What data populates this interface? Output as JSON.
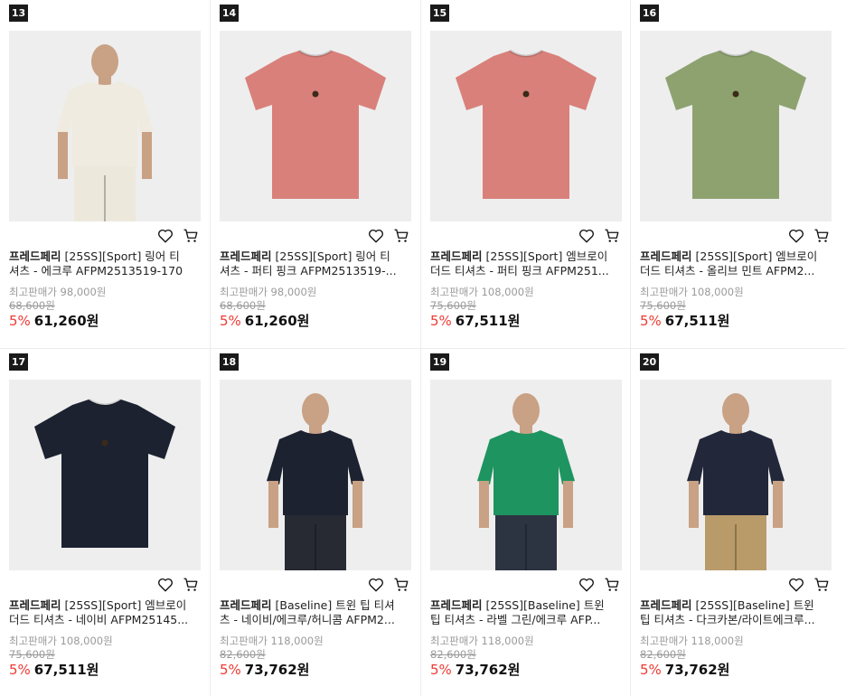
{
  "products": [
    {
      "rank": "13",
      "brand": "프레드페리",
      "title": "[25SS][Sport] 링어 티셔츠 - 에크루 AFPM2513519-170",
      "max_price": "최고판매가 98,000원",
      "original_price": "68,600원",
      "discount": "5%",
      "price": "61,260원",
      "shirt_color": "#efebe0",
      "image": "model",
      "pants_color": "#ece8dc"
    },
    {
      "rank": "14",
      "brand": "프레드페리",
      "title": "[25SS][Sport] 링어 티셔츠 - 퍼티 핑크 AFPM2513519-...",
      "max_price": "최고판매가 98,000원",
      "original_price": "68,600원",
      "discount": "5%",
      "price": "61,260원",
      "shirt_color": "#d9807b",
      "image": "shirt"
    },
    {
      "rank": "15",
      "brand": "프레드페리",
      "title": "[25SS][Sport] 엠브로이더드 티셔츠 - 퍼티 핑크 AFPM251...",
      "max_price": "최고판매가 108,000원",
      "original_price": "75,600원",
      "discount": "5%",
      "price": "67,511원",
      "shirt_color": "#d9807b",
      "image": "shirt"
    },
    {
      "rank": "16",
      "brand": "프레드페리",
      "title": "[25SS][Sport] 엠브로이더드 티셔츠 - 올리브 민트 AFPM2...",
      "max_price": "최고판매가 108,000원",
      "original_price": "75,600원",
      "discount": "5%",
      "price": "67,511원",
      "shirt_color": "#8ea270",
      "image": "shirt"
    },
    {
      "rank": "17",
      "brand": "프레드페리",
      "title": "[25SS][Sport] 엠브로이더드 티셔츠 - 네이비 AFPM25145...",
      "max_price": "최고판매가 108,000원",
      "original_price": "75,600원",
      "discount": "5%",
      "price": "67,511원",
      "shirt_color": "#1c2230",
      "image": "shirt"
    },
    {
      "rank": "18",
      "brand": "프레드페리",
      "title": "[Baseline] 트윈 팁 티셔츠 - 네이비/에크루/허니콤 AFPM2...",
      "max_price": "최고판매가 118,000원",
      "original_price": "82,600원",
      "discount": "5%",
      "price": "73,762원",
      "shirt_color": "#1d2230",
      "image": "model",
      "pants_color": "#272a33"
    },
    {
      "rank": "19",
      "brand": "프레드페리",
      "title": "[25SS][Baseline] 트윈 팁 티셔츠 - 라벨 그린/에크루 AFP...",
      "max_price": "최고판매가 118,000원",
      "original_price": "82,600원",
      "discount": "5%",
      "price": "73,762원",
      "shirt_color": "#1e9460",
      "image": "model",
      "pants_color": "#2c3442"
    },
    {
      "rank": "20",
      "brand": "프레드페리",
      "title": "[25SS][Baseline] 트윈 팁 티셔츠 - 다크카본/라이트에크루...",
      "max_price": "최고판매가 118,000원",
      "original_price": "82,600원",
      "discount": "5%",
      "price": "73,762원",
      "shirt_color": "#22283a",
      "image": "model",
      "pants_color": "#b99b6a"
    }
  ]
}
